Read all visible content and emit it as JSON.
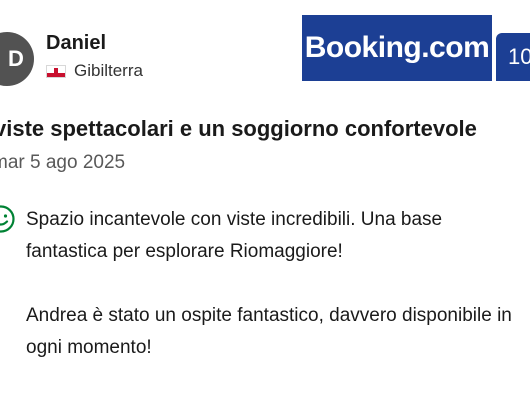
{
  "reviewer": {
    "avatar_initial": "D",
    "name": "Daniel",
    "country": "Gibilterra"
  },
  "brand": {
    "logo_text": "Booking.com",
    "color": "#1c3f94"
  },
  "score_badge": {
    "value": "10"
  },
  "review": {
    "title": "viste spettacolari e un soggiorno confortevole",
    "date": "mar 5 ago 2025",
    "positive_icon": "smiley-face-icon",
    "positive_color": "#008234",
    "paragraphs": [
      "Spazio incantevole con viste incredibili. Una base fantastica per esplorare Riomaggiore!",
      "Andrea è stato un ospite fantastico, davvero disponibile in ogni momento!"
    ]
  }
}
